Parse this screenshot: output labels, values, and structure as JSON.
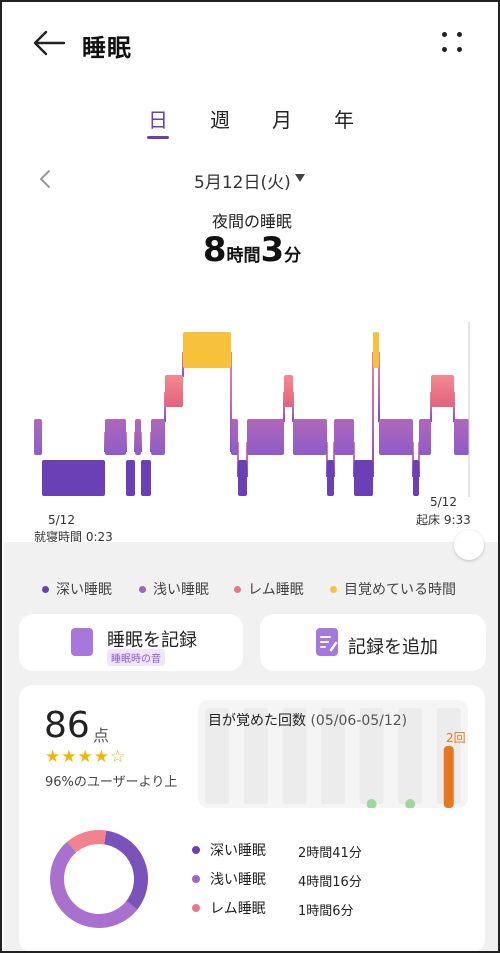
{
  "header": {
    "title": "睡眠",
    "back_icon": "arrow-left-icon",
    "more_icon": "more-vertical-icon"
  },
  "tabs": [
    {
      "label": "日",
      "active": true
    },
    {
      "label": "週"
    },
    {
      "label": "月"
    },
    {
      "label": "年"
    }
  ],
  "date_selector": {
    "date": "5月12日(火)",
    "prev_icon": "chevron-left-icon",
    "caret_icon": "caret-down-icon"
  },
  "summary": {
    "label": "夜間の睡眠",
    "hours": "8",
    "hours_unit": "時間",
    "minutes": "3",
    "minutes_unit": "分"
  },
  "chart": {
    "start_date": "5/12",
    "start_label": "就寝時間 0:23",
    "end_date": "5/12",
    "end_label": "起床 9:33"
  },
  "chart_data": {
    "type": "bar",
    "categories": [
      "深い睡眠",
      "浅い睡眠",
      "レム睡眠",
      "目覚めている時間"
    ],
    "series": [
      {
        "name": "深い睡眠",
        "color": "#6b3fb5"
      },
      {
        "name": "浅い睡眠",
        "color": "#a060c8"
      },
      {
        "name": "レム睡眠",
        "color": "#ef7585"
      },
      {
        "name": "目覚めている時間",
        "color": "#f7c23a"
      }
    ]
  },
  "legend": [
    {
      "label": "深い睡眠",
      "color": "#6b3fb5"
    },
    {
      "label": "浅い睡眠",
      "color": "#a060c8"
    },
    {
      "label": "レム睡眠",
      "color": "#ef7585"
    },
    {
      "label": "目覚めている時間",
      "color": "#f7c23a"
    }
  ],
  "actions": {
    "record_sleep": {
      "label": "睡眠を記録",
      "sub": "睡眠時の音",
      "icon": "moon-phone-icon"
    },
    "add_record": {
      "label": "記録を追加",
      "icon": "edit-note-icon"
    }
  },
  "score": {
    "value": "86",
    "unit": "点",
    "stars": "★★★★☆",
    "rating": 4.5,
    "rank_text": "96%のユーザーより上"
  },
  "wake_count": {
    "title": "目が覚めた回数",
    "range": "(05/06-05/12)",
    "value_label": "2回",
    "values": [
      0,
      0,
      0,
      0,
      1,
      1,
      2
    ]
  },
  "stages": [
    {
      "label": "深い睡眠",
      "value": "2時間41分",
      "color": "#6b3fb5",
      "minutes": 161
    },
    {
      "label": "浅い睡眠",
      "value": "4時間16分",
      "color": "#a060c8",
      "minutes": 256
    },
    {
      "label": "レム睡眠",
      "value": "1時間6分",
      "color": "#ef7585",
      "minutes": 66
    }
  ]
}
